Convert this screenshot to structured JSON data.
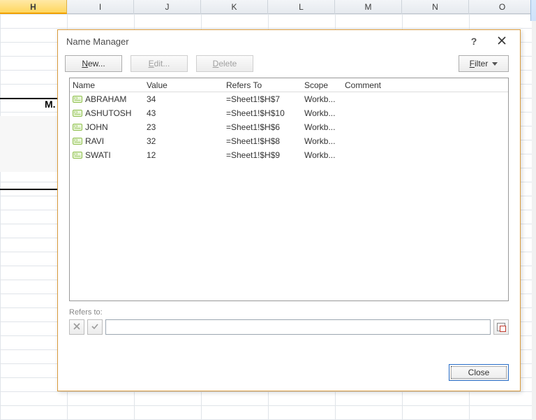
{
  "columns": [
    "H",
    "I",
    "J",
    "K",
    "L",
    "M",
    "N",
    "O"
  ],
  "active_column_index": 0,
  "grid_clipped_text": "M.",
  "dialog": {
    "title": "Name Manager",
    "help_glyph": "?",
    "new_label": "New...",
    "new_uline": "N",
    "edit_label": "Edit...",
    "edit_uline": "E",
    "delete_label": "Delete",
    "delete_uline": "D",
    "filter_label": "Filter",
    "filter_uline": "F",
    "headers": {
      "name": "Name",
      "value": "Value",
      "refers": "Refers To",
      "scope": "Scope",
      "comment": "Comment"
    },
    "rows": [
      {
        "name": "ABRAHAM",
        "value": "34",
        "refers": "=Sheet1!$H$7",
        "scope": "Workb...",
        "comment": ""
      },
      {
        "name": "ASHUTOSH",
        "value": "43",
        "refers": "=Sheet1!$H$10",
        "scope": "Workb...",
        "comment": ""
      },
      {
        "name": "JOHN",
        "value": "23",
        "refers": "=Sheet1!$H$6",
        "scope": "Workb...",
        "comment": ""
      },
      {
        "name": "RAVI",
        "value": "32",
        "refers": "=Sheet1!$H$8",
        "scope": "Workb...",
        "comment": ""
      },
      {
        "name": "SWATI",
        "value": "12",
        "refers": "=Sheet1!$H$9",
        "scope": "Workb...",
        "comment": ""
      }
    ],
    "refers_to_label": "Refers to:",
    "refers_to_value": "",
    "close_label": "Close"
  }
}
